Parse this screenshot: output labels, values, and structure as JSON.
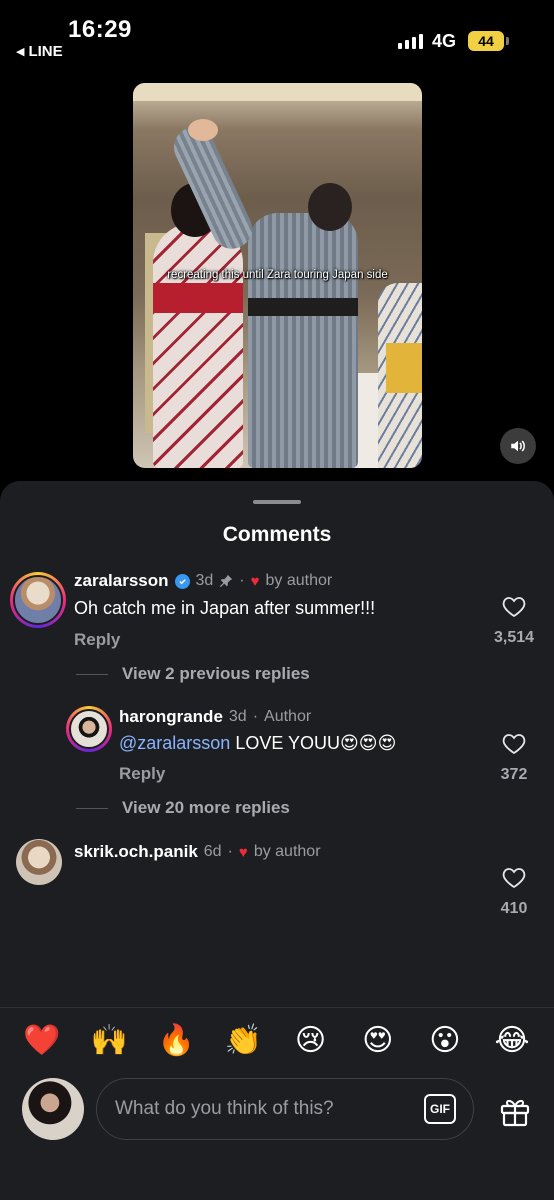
{
  "status_bar": {
    "time": "16:29",
    "back_app": "LINE",
    "network": "4G",
    "battery": "44"
  },
  "video": {
    "caption": "recreating this until Zara touring Japan side"
  },
  "comments_sheet": {
    "title": "Comments",
    "comments": [
      {
        "username": "zaralarsson",
        "verified": true,
        "age": "3d",
        "pinned": true,
        "liked_by_author": "by author",
        "text": "Oh catch me in Japan after summer!!!",
        "reply_label": "Reply",
        "likes": "3,514",
        "view_previous": "View 2 previous replies"
      },
      {
        "username": "harongrande",
        "age": "3d",
        "badge": "Author",
        "mention": "@zaralarsson",
        "text": " LOVE YOUU😍😍😍",
        "reply_label": "Reply",
        "likes": "372",
        "view_more": "View 20 more replies"
      },
      {
        "username": "skrik.och.panik",
        "age": "6d",
        "liked_by_author": "by author",
        "likes": "410"
      }
    ],
    "quick_reactions": [
      "❤️",
      "🙌",
      "🔥",
      "👏",
      "😢",
      "😍",
      "😮",
      "😂"
    ],
    "input_placeholder": "What do you think of this?",
    "gif_label": "GIF"
  },
  "icons": {
    "sound": "speaker-icon",
    "like": "heart-outline-icon",
    "pin": "pin-icon",
    "gift": "gift-icon"
  },
  "colors": {
    "accent_blue": "#3897f0",
    "heart_red": "#ee2b3b",
    "sheet_bg": "#1c1e21",
    "battery": "#f2d043"
  }
}
